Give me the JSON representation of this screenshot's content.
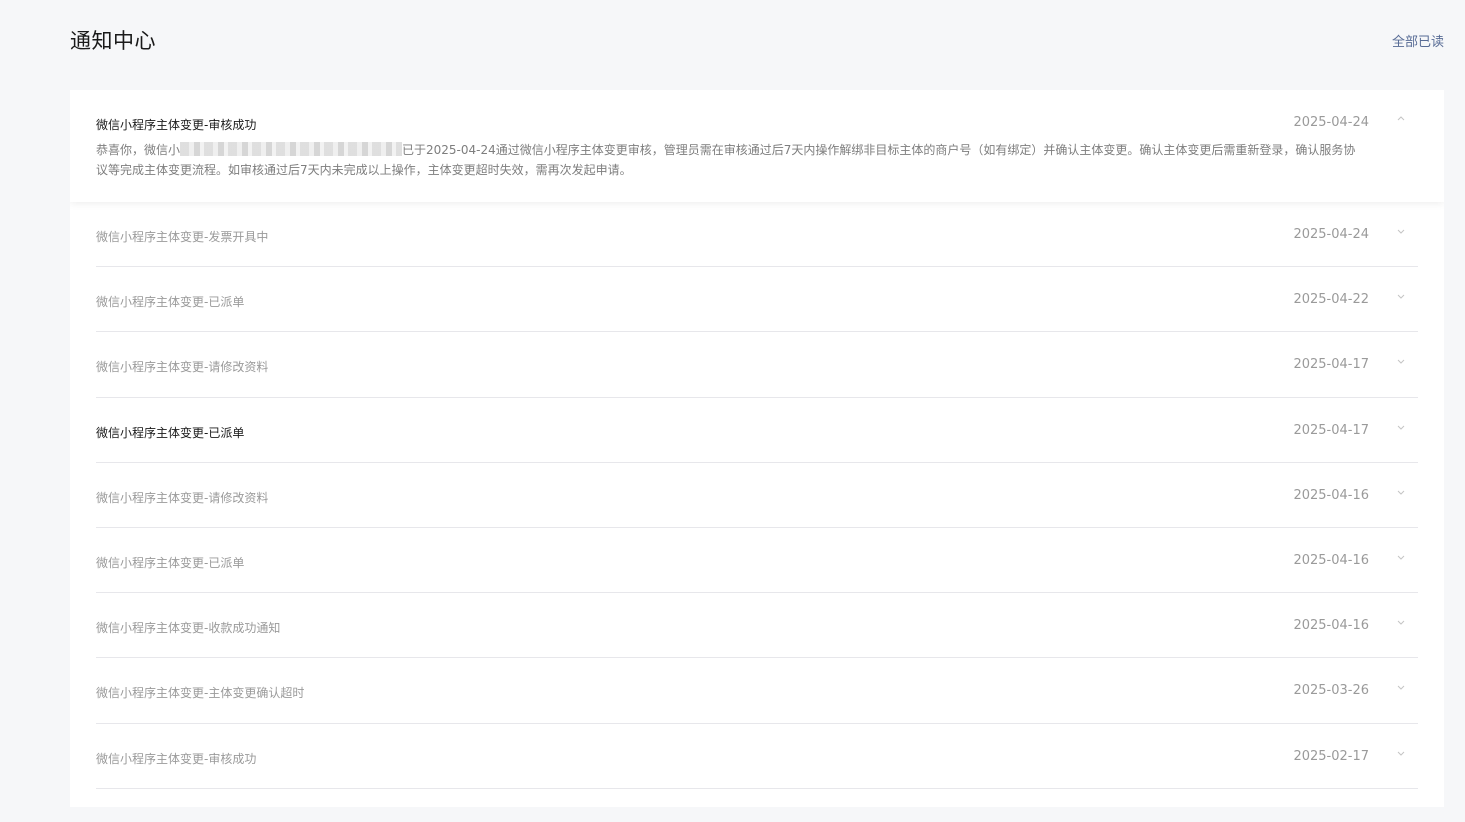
{
  "header": {
    "title": "通知中心",
    "mark_all_read": "全部已读"
  },
  "notifications": [
    {
      "title": "微信小程序主体变更-审核成功",
      "date": "2025-04-24",
      "expanded": true,
      "unread": true,
      "body_prefix": "恭喜你，微信小",
      "body_suffix": "已于2025-04-24通过微信小程序主体变更审核，管理员需在审核通过后7天内操作解绑非目标主体的商户号（如有绑定）并确认主体变更。确认主体变更后需重新登录，确认服务协议等完成主体变更流程。如审核通过后7天内未完成以上操作，主体变更超时失效，需再次发起申请。"
    },
    {
      "title": "微信小程序主体变更-发票开具中",
      "date": "2025-04-24",
      "unread": false
    },
    {
      "title": "微信小程序主体变更-已派单",
      "date": "2025-04-22",
      "unread": false
    },
    {
      "title": "微信小程序主体变更-请修改资料",
      "date": "2025-04-17",
      "unread": false
    },
    {
      "title": "微信小程序主体变更-已派单",
      "date": "2025-04-17",
      "unread": true
    },
    {
      "title": "微信小程序主体变更-请修改资料",
      "date": "2025-04-16",
      "unread": false
    },
    {
      "title": "微信小程序主体变更-已派单",
      "date": "2025-04-16",
      "unread": false
    },
    {
      "title": "微信小程序主体变更-收款成功通知",
      "date": "2025-04-16",
      "unread": false
    },
    {
      "title": "微信小程序主体变更-主体变更确认超时",
      "date": "2025-03-26",
      "unread": false
    },
    {
      "title": "微信小程序主体变更-审核成功",
      "date": "2025-02-17",
      "unread": false
    }
  ],
  "icons": {
    "expanded": "chevron-up-icon",
    "collapsed": "chevron-down-icon"
  },
  "colors": {
    "link": "#576b95",
    "unread_title": "#1a1a1a",
    "read_title": "#9a9a9a",
    "divider": "#e7e7eb",
    "page_bg": "#f6f7f9"
  }
}
